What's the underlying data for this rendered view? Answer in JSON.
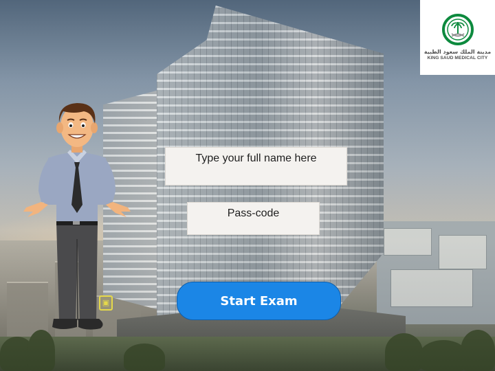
{
  "logo": {
    "arabic_text": "مدينة الملك سعود الطبية",
    "english_text": "KING SAUD MEDICAL CITY",
    "icon": "palm-and-swords-emblem",
    "brand_color": "#0d8a3e"
  },
  "form": {
    "name_placeholder": "Type your full name here",
    "passcode_placeholder": "Pass-code"
  },
  "actions": {
    "start_label": "Start Exam",
    "start_color": "#1b86e6"
  },
  "character": {
    "icon": "presenter-man-illustration"
  },
  "nav_hint": {
    "icon": "yellow-nav-glyph"
  }
}
